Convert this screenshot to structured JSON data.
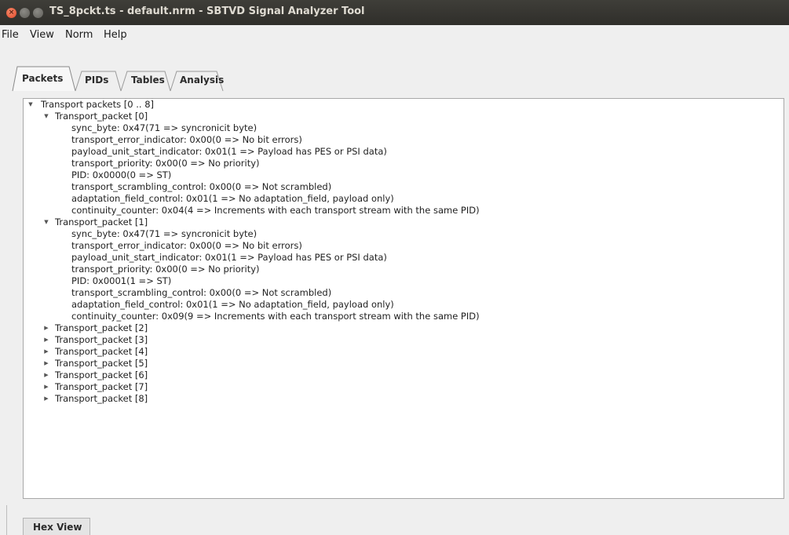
{
  "window": {
    "title": "TS_8pckt.ts - default.nrm - SBTVD Signal Analyzer Tool",
    "close_glyph": "×"
  },
  "menu": [
    "File",
    "View",
    "Norm",
    "Help"
  ],
  "tabs": [
    {
      "label": "Packets",
      "active": true
    },
    {
      "label": "PIDs",
      "active": false
    },
    {
      "label": "Tables",
      "active": false
    },
    {
      "label": "Analysis",
      "active": false
    }
  ],
  "tree": {
    "root": "Transport packets [0 .. 8]",
    "packets": [
      {
        "label": "Transport_packet [0]",
        "expanded": true,
        "fields": [
          "sync_byte: 0x47(71 => syncronicit byte)",
          "transport_error_indicator: 0x00(0 => No bit errors)",
          "payload_unit_start_indicator: 0x01(1 => Payload has PES or PSI data)",
          "transport_priority: 0x00(0 => No priority)",
          "PID: 0x0000(0 => ST)",
          "transport_scrambling_control: 0x00(0 => Not scrambled)",
          "adaptation_field_control: 0x01(1 => No adaptation_field, payload only)",
          "continuity_counter: 0x04(4 => Increments with each transport stream with the same PID)"
        ]
      },
      {
        "label": "Transport_packet [1]",
        "expanded": true,
        "fields": [
          "sync_byte: 0x47(71 => syncronicit byte)",
          "transport_error_indicator: 0x00(0 => No bit errors)",
          "payload_unit_start_indicator: 0x01(1 => Payload has PES or PSI data)",
          "transport_priority: 0x00(0 => No priority)",
          "PID: 0x0001(1 => ST)",
          "transport_scrambling_control: 0x00(0 => Not scrambled)",
          "adaptation_field_control: 0x01(1 => No adaptation_field, payload only)",
          "continuity_counter: 0x09(9 => Increments with each transport stream with the same PID)"
        ]
      },
      {
        "label": "Transport_packet [2]",
        "expanded": false,
        "fields": []
      },
      {
        "label": "Transport_packet [3]",
        "expanded": false,
        "fields": []
      },
      {
        "label": "Transport_packet [4]",
        "expanded": false,
        "fields": []
      },
      {
        "label": "Transport_packet [5]",
        "expanded": false,
        "fields": []
      },
      {
        "label": "Transport_packet [6]",
        "expanded": false,
        "fields": []
      },
      {
        "label": "Transport_packet [7]",
        "expanded": false,
        "fields": []
      },
      {
        "label": "Transport_packet [8]",
        "expanded": false,
        "fields": []
      }
    ],
    "expanded_arrow": "▼",
    "collapsed_arrow": "▶"
  },
  "bottom_tab": {
    "label": "Hex View"
  }
}
